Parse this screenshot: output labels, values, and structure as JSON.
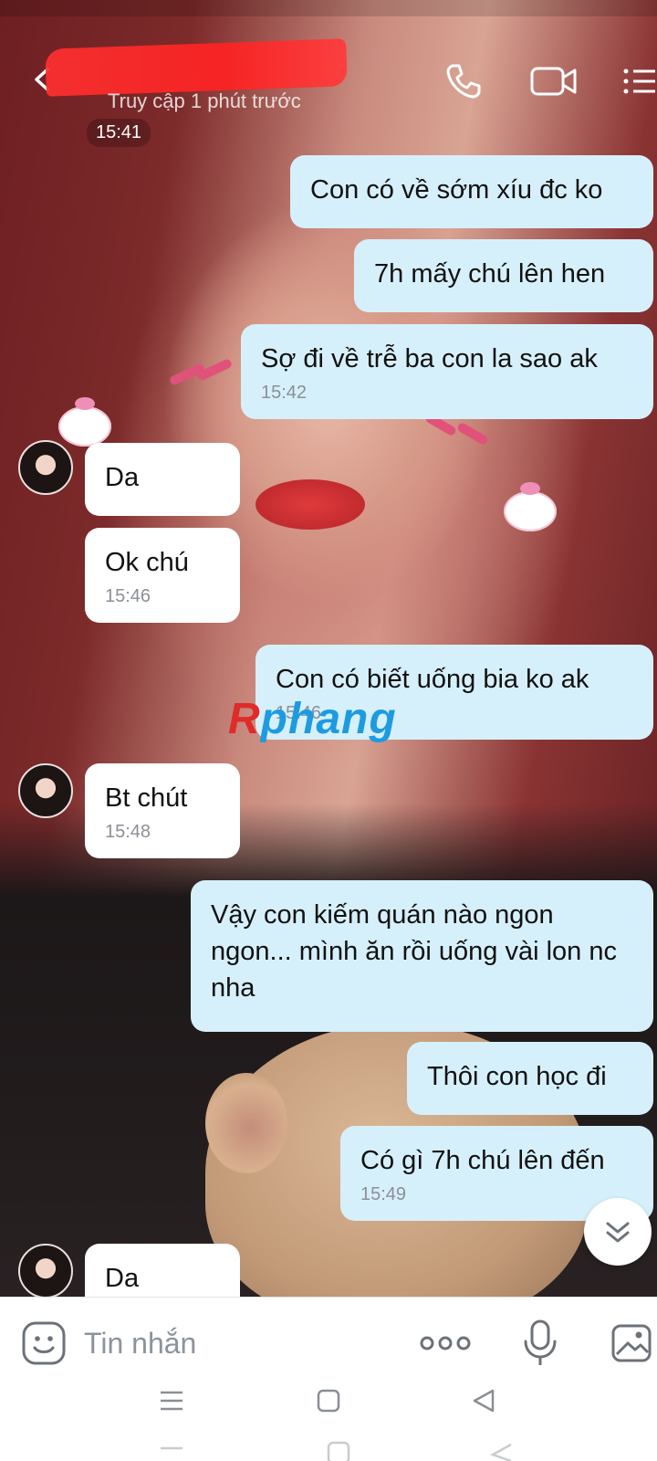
{
  "header": {
    "contact_name": "",
    "last_seen": "Truy cập 1 phút trước",
    "time_label": "15:41"
  },
  "messages": [
    {
      "dir": "out",
      "text": "Con có về sớm xíu đc ko",
      "time": ""
    },
    {
      "dir": "out",
      "text": "7h mấy chú lên hen",
      "time": ""
    },
    {
      "dir": "out",
      "text": "Sợ đi về trễ ba con la sao ak",
      "time": "15:42"
    },
    {
      "dir": "in",
      "text": "Da",
      "time": ""
    },
    {
      "dir": "in",
      "text": "Ok chú",
      "time": "15:46"
    },
    {
      "dir": "out",
      "text": "Con có biết uống bia ko ak",
      "time": "15:46"
    },
    {
      "dir": "in",
      "text": "Bt chút",
      "time": "15:48"
    },
    {
      "dir": "out",
      "text": "Vậy con kiếm quán nào ngon ngon... mình ăn rồi uống vài lon nc nha",
      "time": ""
    },
    {
      "dir": "out",
      "text": "Thôi con học đi",
      "time": ""
    },
    {
      "dir": "out",
      "text": "Có gì 7h chú lên đến",
      "time": "15:49"
    },
    {
      "dir": "in",
      "text": "Da",
      "time": ""
    }
  ],
  "watermark": {
    "first": "R",
    "rest": "phang"
  },
  "composer": {
    "placeholder": "Tin nhắn"
  },
  "icons": {
    "back": "chevron-left-icon",
    "call": "phone-icon",
    "video": "video-camera-icon",
    "menu": "list-menu-icon",
    "emoji": "smiley-icon",
    "more": "more-dots-icon",
    "mic": "microphone-icon",
    "gallery": "image-icon",
    "scroll": "double-chevron-down-icon"
  },
  "colors": {
    "outgoing_bubble": "#d6f0fb",
    "incoming_bubble": "#ffffff",
    "timestamp": "#8b8f96",
    "redaction": "#ff2a2a"
  }
}
